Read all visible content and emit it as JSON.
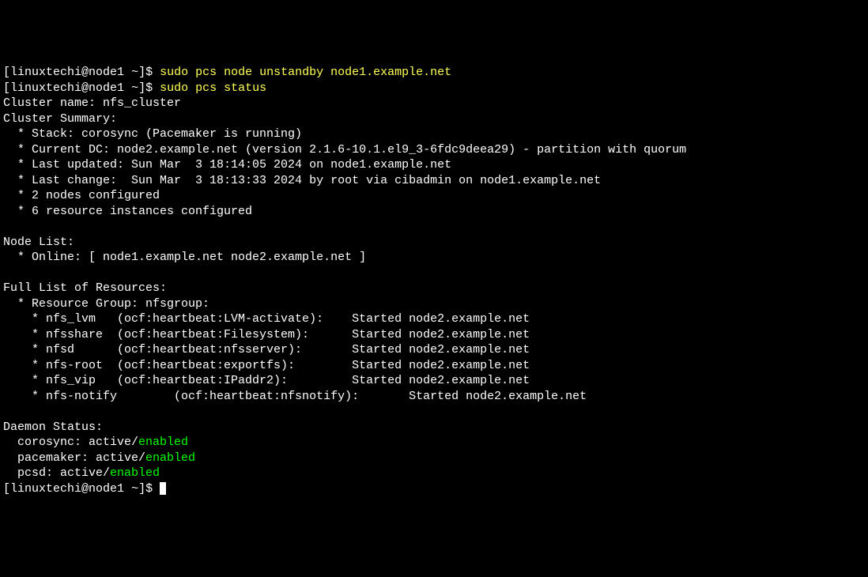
{
  "lines": {
    "prompt1_user": "linuxtechi",
    "prompt1_host": "node1",
    "prompt1_path": "~",
    "cmd1": "sudo pcs node unstandby node1.example.net",
    "cmd2": "sudo pcs status",
    "l1": "Cluster name: nfs_cluster",
    "l2": "Cluster Summary:",
    "l3": "  * Stack: corosync (Pacemaker is running)",
    "l4": "  * Current DC: node2.example.net (version 2.1.6-10.1.el9_3-6fdc9deea29) - partition with quorum",
    "l5": "  * Last updated: Sun Mar  3 18:14:05 2024 on node1.example.net",
    "l6": "  * Last change:  Sun Mar  3 18:13:33 2024 by root via cibadmin on node1.example.net",
    "l7": "  * 2 nodes configured",
    "l8": "  * 6 resource instances configured",
    "l9": "",
    "l10": "Node List:",
    "l11": "  * Online: [ node1.example.net node2.example.net ]",
    "l12": "",
    "l13": "Full List of Resources:",
    "l14": "  * Resource Group: nfsgroup:",
    "l15": "    * nfs_lvm   (ocf:heartbeat:LVM-activate):    Started node2.example.net",
    "l16": "    * nfsshare  (ocf:heartbeat:Filesystem):      Started node2.example.net",
    "l17": "    * nfsd      (ocf:heartbeat:nfsserver):       Started node2.example.net",
    "l18": "    * nfs-root  (ocf:heartbeat:exportfs):        Started node2.example.net",
    "l19": "    * nfs_vip   (ocf:heartbeat:IPaddr2):         Started node2.example.net",
    "l20": "    * nfs-notify        (ocf:heartbeat:nfsnotify):       Started node2.example.net",
    "l21": "",
    "l22": "Daemon Status:",
    "d1_pre": "  corosync: active/",
    "d1_enabled": "enabled",
    "d2_pre": "  pacemaker: active/",
    "d2_enabled": "enabled",
    "d3_pre": "  pcsd: active/",
    "d3_enabled": "enabled"
  }
}
